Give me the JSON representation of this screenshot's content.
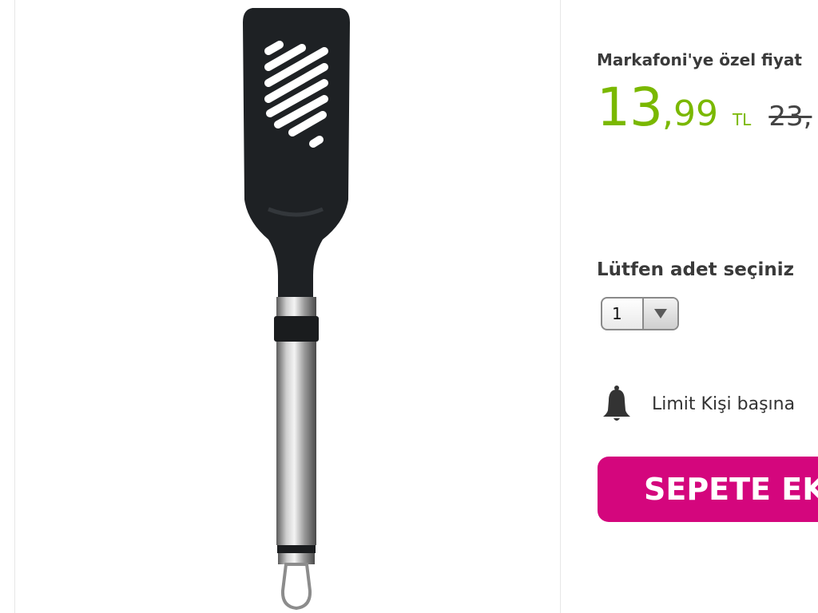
{
  "pricing": {
    "special_label": "Markafoni'ye özel fiyat",
    "price_main": "13",
    "price_decimal": ",99",
    "currency": "TL",
    "old_price": "23,",
    "colors": {
      "price": "#7ab800",
      "text": "#3a3a3a"
    }
  },
  "quantity": {
    "label": "Lütfen adet seçiniz",
    "selected": "1"
  },
  "limit": {
    "text": "Limit Kişi başına",
    "icon": "bell-icon"
  },
  "cart": {
    "button_label": "SEPETE EK",
    "color": "#d4067d"
  },
  "product_image": {
    "icon": "slotted-spatula-image"
  }
}
